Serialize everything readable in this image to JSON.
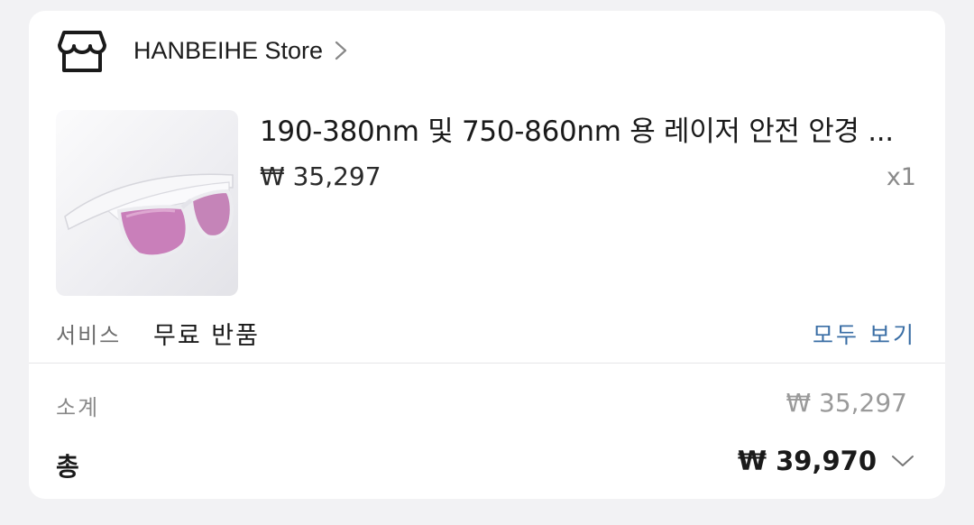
{
  "store": {
    "icon": "storefront-icon",
    "name": "HANBEIHE Store",
    "chevron_icon": "chevron-right-icon"
  },
  "product": {
    "image": "laser-safety-glasses-image",
    "title": "190-380nm 및 750-860nm 용 레이저 안전 안경 ...",
    "price": "₩ 35,297",
    "quantity": "x1"
  },
  "service": {
    "label": "서비스",
    "value": "무료 반품",
    "view_all": "모두 보기"
  },
  "summary": {
    "subtotal_label": "소계",
    "subtotal_value": "₩ 35,297",
    "total_label": "총",
    "total_value": "₩ 39,970",
    "expand_icon": "chevron-down-icon"
  },
  "colors": {
    "page_background": "#f2f2f4",
    "card_background": "#ffffff",
    "link": "#3a6ea5",
    "lens": "#c77fb8"
  }
}
